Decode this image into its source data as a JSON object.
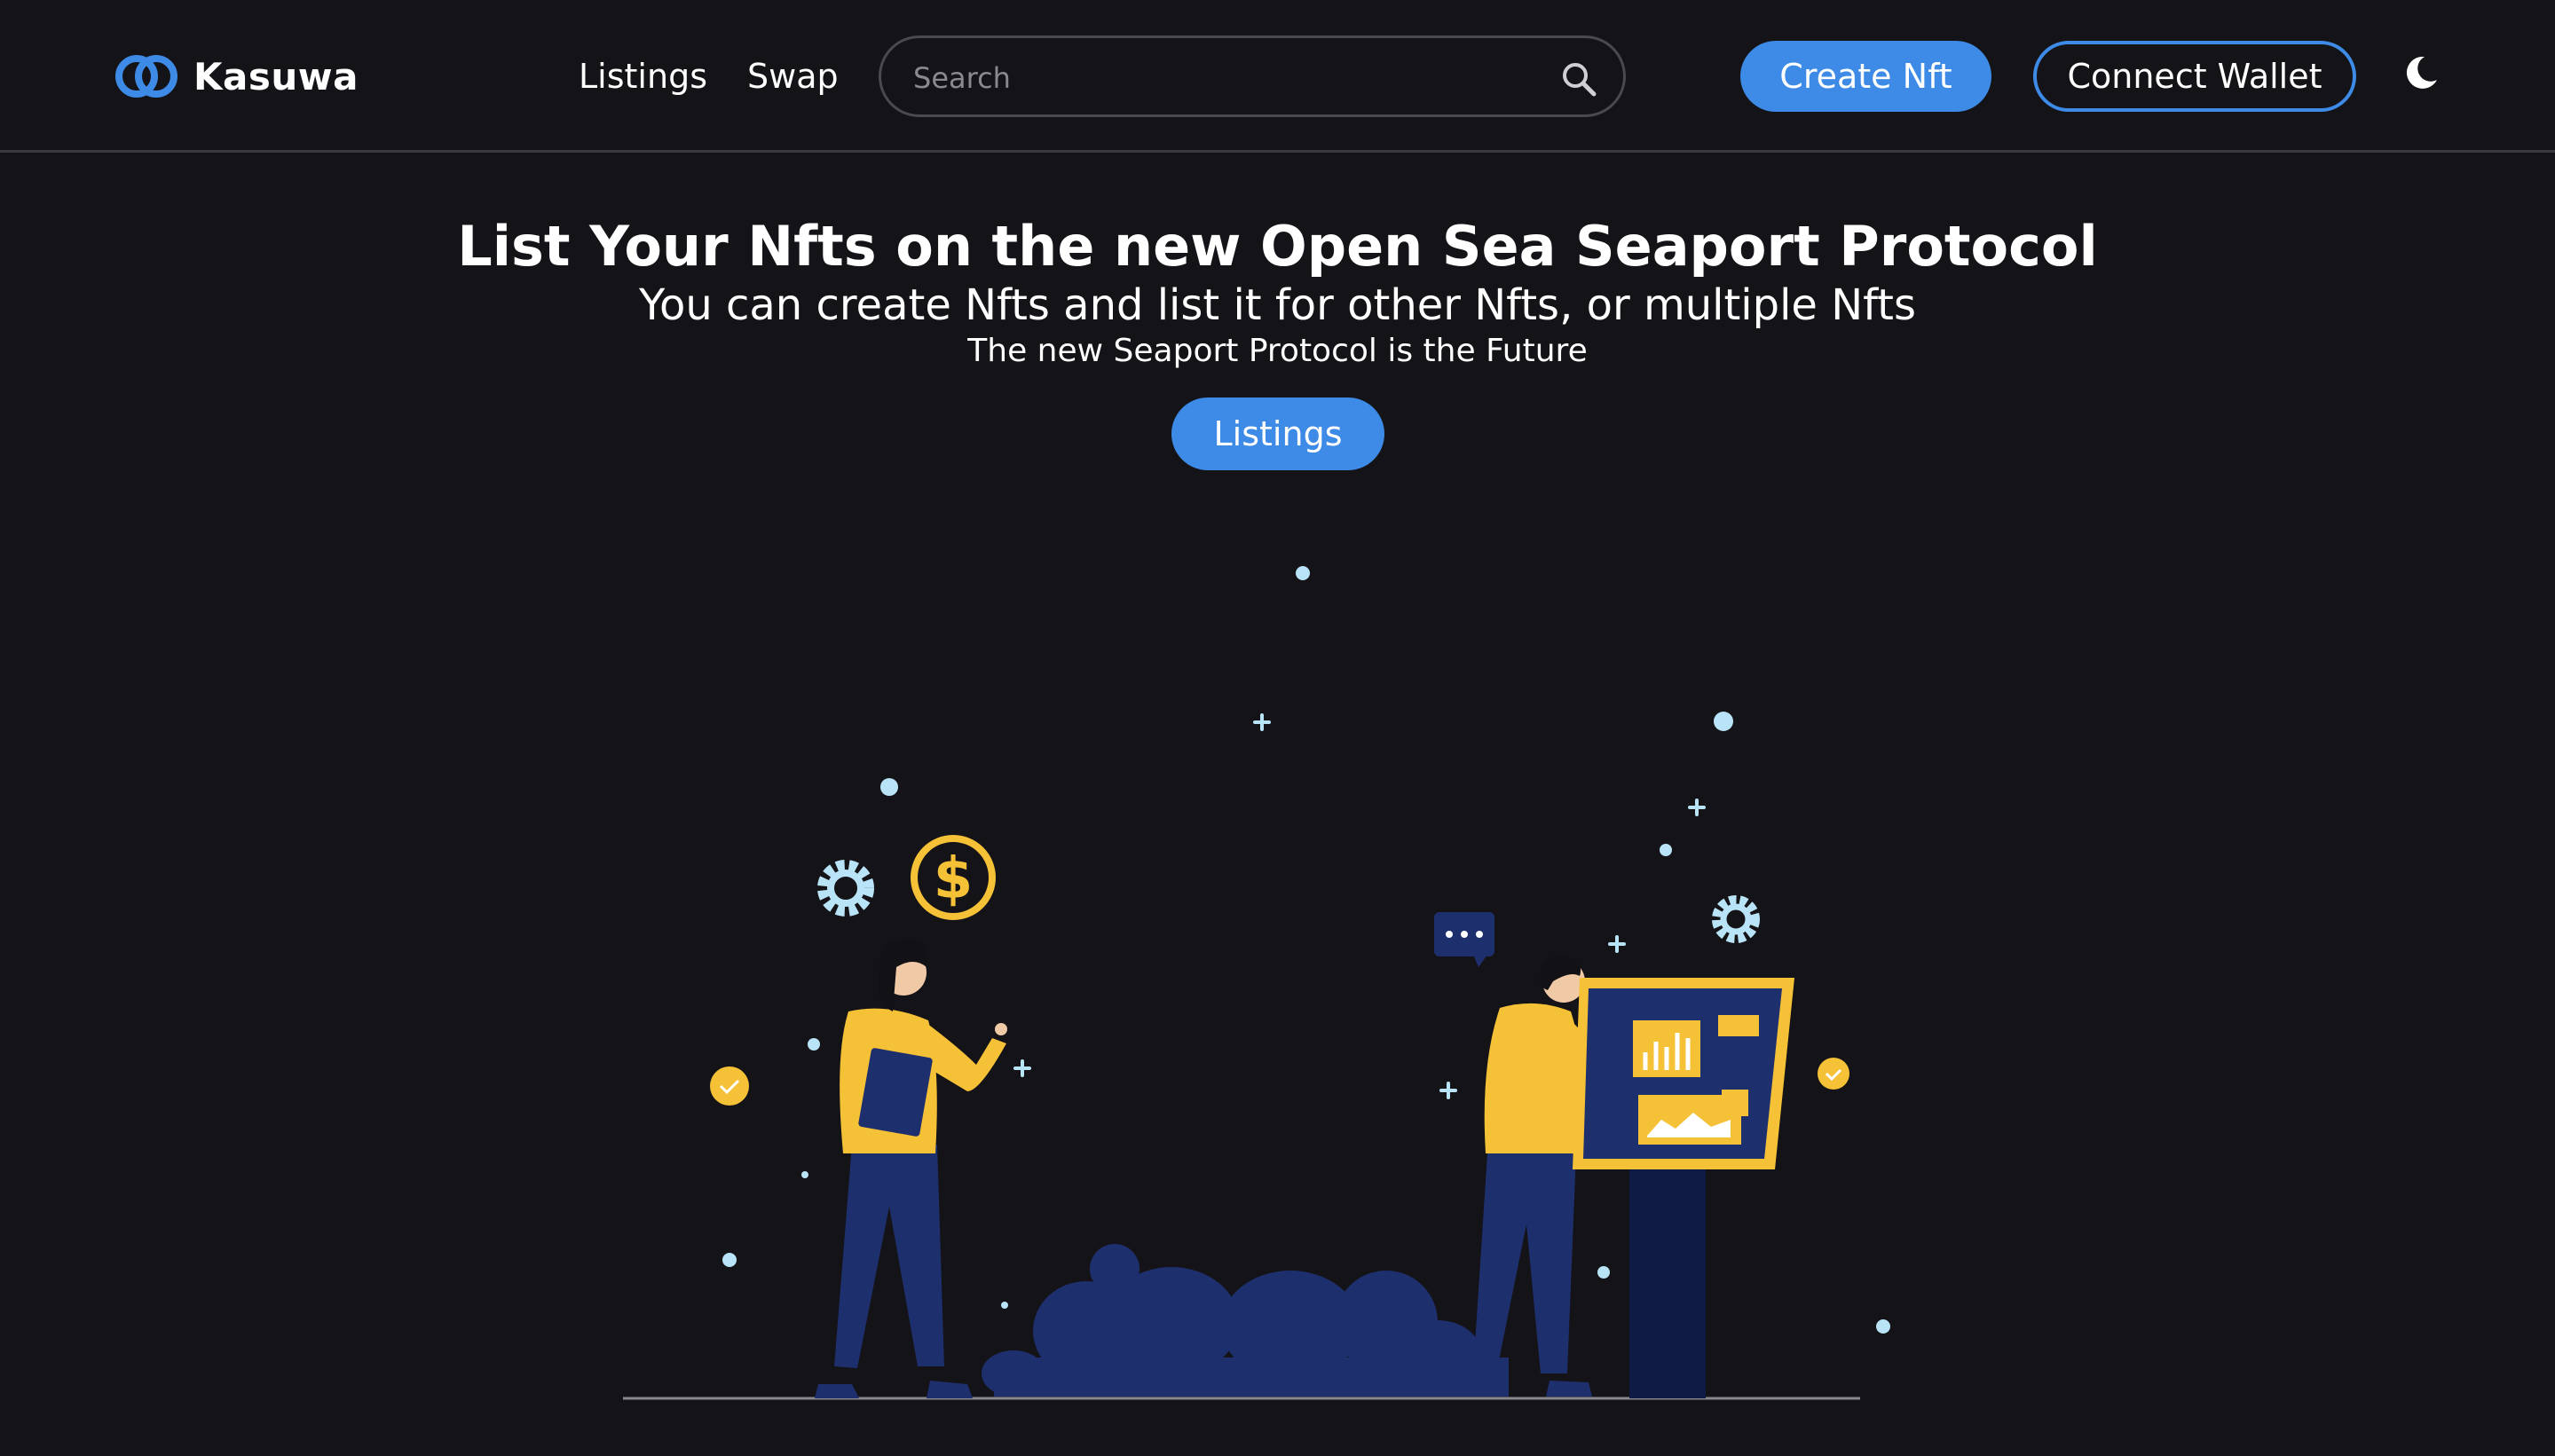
{
  "navbar": {
    "brand": {
      "name": "Kasuwa",
      "logo_icon": "interlocked-rings-logo-icon",
      "logo_color": "#3d8be6"
    },
    "links": [
      {
        "label": "Listings"
      },
      {
        "label": "Swap"
      }
    ],
    "search": {
      "placeholder": "Search",
      "value": "",
      "icon": "search-icon"
    },
    "create_button_label": "Create Nft",
    "connect_button_label": "Connect Wallet",
    "theme_toggle_icon": "moon-icon"
  },
  "hero": {
    "title": "List Your Nfts on the new Open Sea Seaport Protocol",
    "subtitle": "You can create Nfts and list it for other Nfts, or multiple Nfts",
    "tagline": "The new Seaport Protocol is the Future",
    "button_label": "Listings"
  },
  "colors": {
    "background": "#141317",
    "accent": "#3d8be6",
    "illustration_yellow": "#f5c137",
    "illustration_navy": "#1e2f6e",
    "illustration_light_blue": "#b9e3f7"
  }
}
